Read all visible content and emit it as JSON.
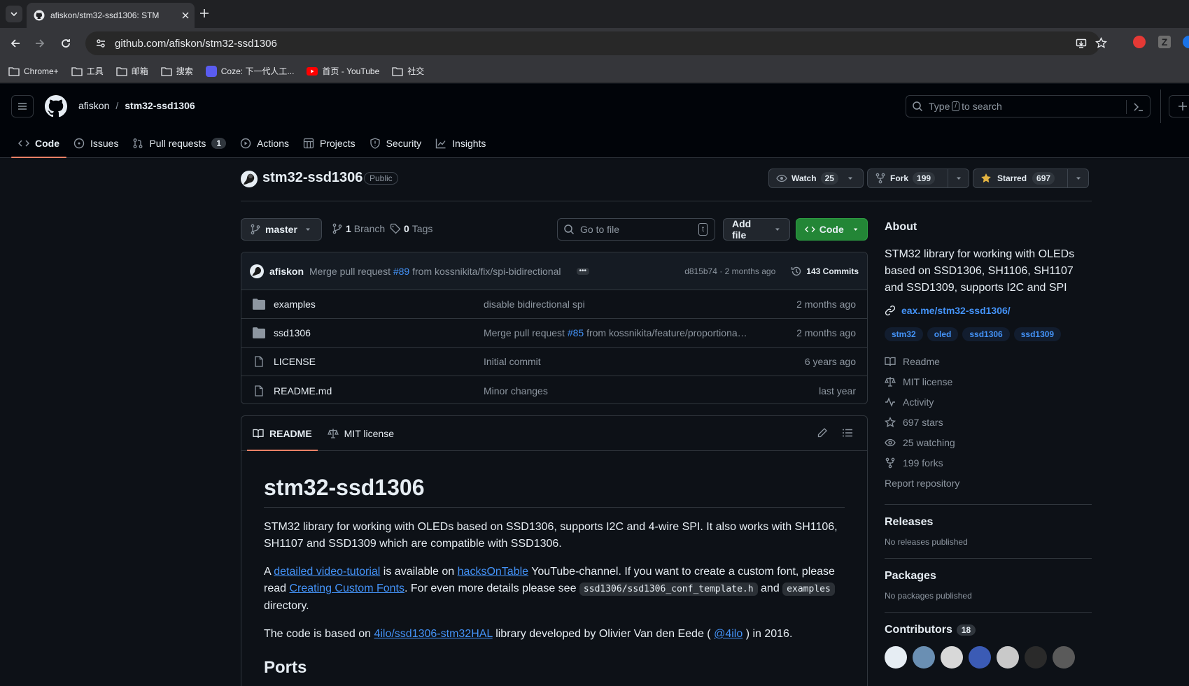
{
  "browser": {
    "tab_title": "afiskon/stm32-ssd1306: STM",
    "url": "github.com/afiskon/stm32-ssd1306",
    "bookmarks": [
      "Chrome+",
      "工具",
      "邮箱",
      "搜索",
      "Coze: 下一代人工...",
      "首页 - YouTube",
      "社交"
    ]
  },
  "header": {
    "owner": "afiskon",
    "slash": "/",
    "repo": "stm32-ssd1306",
    "search_pre": "Type",
    "search_key": "/",
    "search_post": "to search",
    "nav": [
      {
        "label": "Code"
      },
      {
        "label": "Issues"
      },
      {
        "label": "Pull requests",
        "count": "1"
      },
      {
        "label": "Actions"
      },
      {
        "label": "Projects"
      },
      {
        "label": "Security"
      },
      {
        "label": "Insights"
      }
    ]
  },
  "repo": {
    "name": "stm32-ssd1306",
    "visibility": "Public",
    "watch_label": "Watch",
    "watch_count": "25",
    "fork_label": "Fork",
    "fork_count": "199",
    "star_label": "Starred",
    "star_count": "697"
  },
  "files": {
    "branch": "master",
    "branches_count": "1",
    "branches_label": "Branch",
    "tags_count": "0",
    "tags_label": "Tags",
    "goto_placeholder": "Go to file",
    "goto_key": "t",
    "add_file": "Add file",
    "code_btn": "Code",
    "commit": {
      "author": "afiskon",
      "msg_pre": "Merge pull request",
      "pr": "#89",
      "msg_post": "from kossnikita/fix/spi-bidirectional",
      "sha_time": "d815b74 · 2 months ago",
      "commits": "143 Commits"
    },
    "rows": [
      {
        "name": "examples",
        "type": "dir",
        "msg_pre": "disable bidirectional spi",
        "pr": "",
        "msg_post": "",
        "when": "2 months ago"
      },
      {
        "name": "ssd1306",
        "type": "dir",
        "msg_pre": "Merge pull request",
        "pr": "#85",
        "msg_post": "from kossnikita/feature/proportiona…",
        "when": "2 months ago"
      },
      {
        "name": "LICENSE",
        "type": "file",
        "msg_pre": "Initial commit",
        "pr": "",
        "msg_post": "",
        "when": "6 years ago"
      },
      {
        "name": "README.md",
        "type": "file",
        "msg_pre": "Minor changes",
        "pr": "",
        "msg_post": "",
        "when": "last year"
      }
    ]
  },
  "readme": {
    "tab_readme": "README",
    "tab_license": "MIT license",
    "title": "stm32-ssd1306",
    "p1": "STM32 library for working with OLEDs based on SSD1306, supports I2C and 4-wire SPI. It also works with SH1106, SH1107 and SSD1309 which are compatible with SSD1306.",
    "p2_a": "A",
    "p2_link1": "detailed video-tutorial",
    "p2_b": "is available on",
    "p2_link2": "hacksOnTable",
    "p2_c": "YouTube-channel. If you want to create a custom font, please read",
    "p2_link3": "Creating Custom Fonts",
    "p2_d": ". For even more details please see",
    "p2_code1": "ssd1306/ssd1306_conf_template.h",
    "p2_e": "and",
    "p2_code2": "examples",
    "p2_f": "directory.",
    "p3_a": "The code is based on",
    "p3_link1": "4ilo/ssd1306-stm32HAL",
    "p3_b": "library developed by Olivier Van den Eede (",
    "p3_link2": "@4ilo",
    "p3_c": ") in 2016.",
    "h2": "Ports"
  },
  "about": {
    "title": "About",
    "description": "STM32 library for working with OLEDs based on SSD1306, SH1106, SH1107 and SSD1309, supports I2C and SPI",
    "link": "eax.me/stm32-ssd1306/",
    "topics": [
      "stm32",
      "oled",
      "ssd1306",
      "ssd1309"
    ],
    "items": [
      {
        "icon": "book-icon",
        "label": "Readme"
      },
      {
        "icon": "law-icon",
        "label": "MIT license"
      },
      {
        "icon": "pulse-icon",
        "label": "Activity"
      },
      {
        "icon": "star-icon",
        "label": "697 stars"
      },
      {
        "icon": "eye-icon",
        "label": "25 watching"
      },
      {
        "icon": "fork-icon",
        "label": "199 forks"
      }
    ],
    "report": "Report repository",
    "releases_title": "Releases",
    "releases_text": "No releases published",
    "packages_title": "Packages",
    "packages_text": "No packages published",
    "contributors_title": "Contributors",
    "contributors_count": "18"
  },
  "colors": {
    "accent": "#f78166",
    "link": "#4493f8",
    "green": "#238636",
    "bg": "#0d1117",
    "star": "#e3b341"
  }
}
